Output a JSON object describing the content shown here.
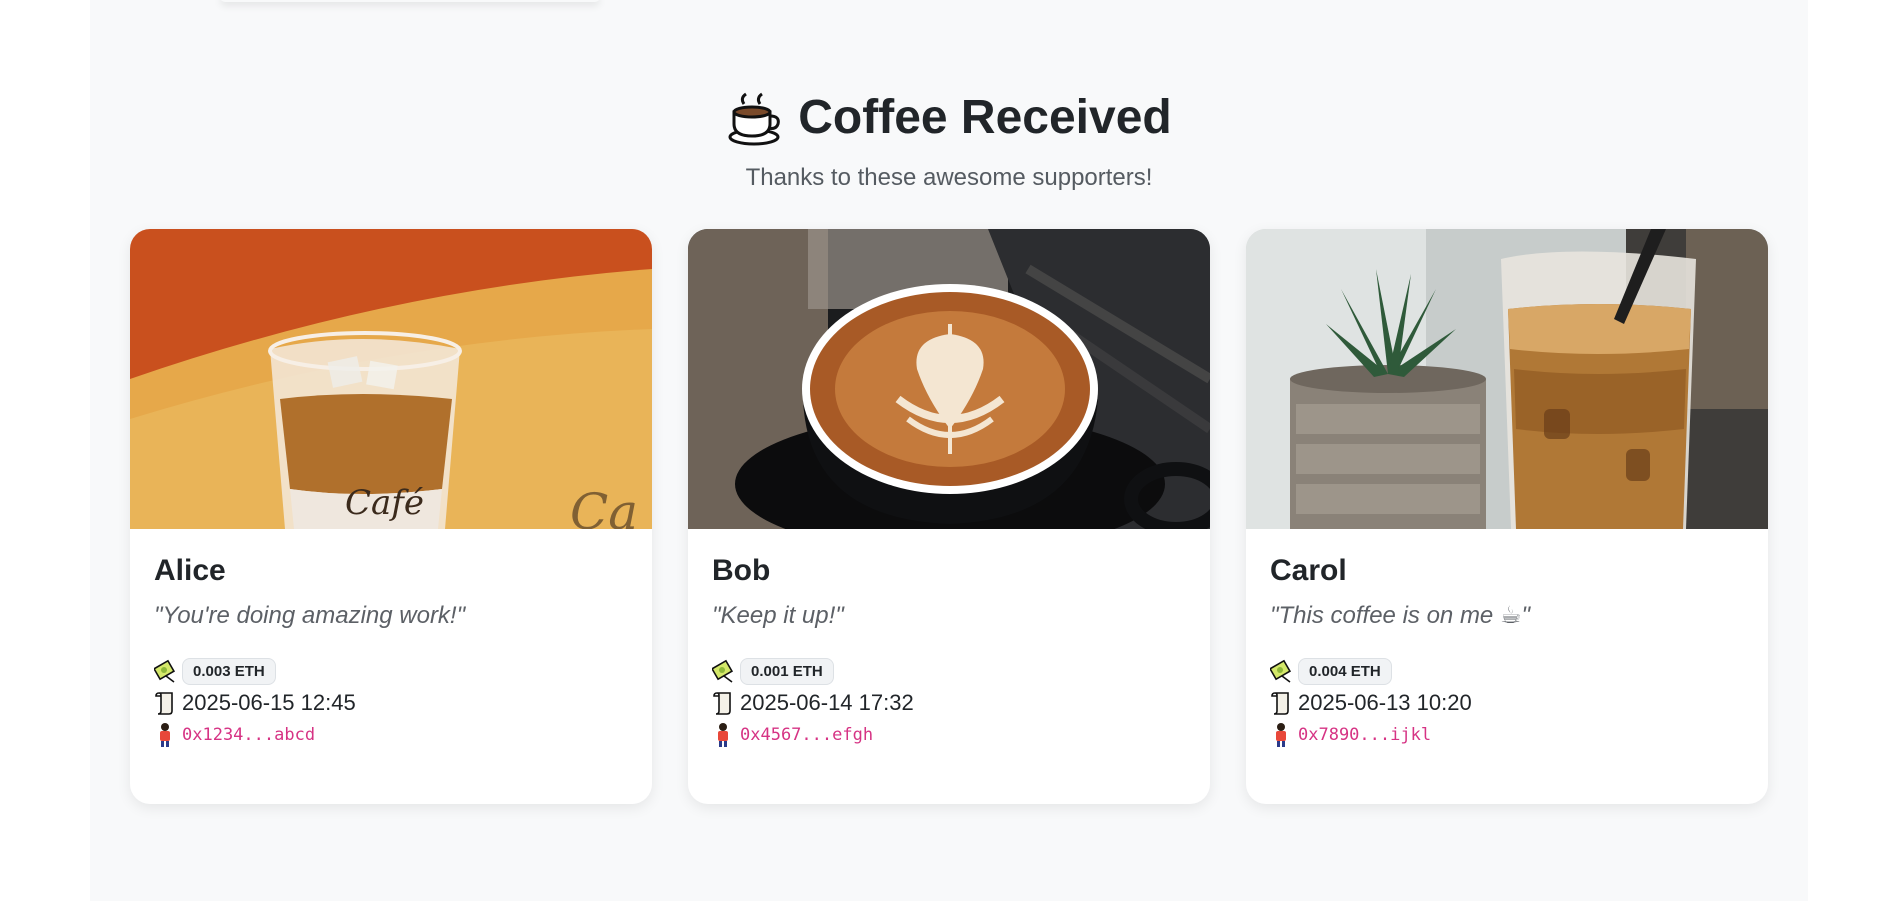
{
  "header": {
    "icon": "coffee-cup-icon",
    "title": "Coffee Received",
    "subtitle": "Thanks to these awesome supporters!"
  },
  "colors": {
    "page_bg": "#f8f9fa",
    "address": "#d63384",
    "badge_bg": "#f1f3f5"
  },
  "supporters": [
    {
      "name": "Alice",
      "message": "\"You're doing amazing work!\"",
      "amount": "0.003 ETH",
      "date": "2025-06-15 12:45",
      "address": "0x1234...abcd",
      "photo": "iced-latte-photo"
    },
    {
      "name": "Bob",
      "message": "\"Keep it up!\"",
      "amount": "0.001 ETH",
      "date": "2025-06-14 17:32",
      "address": "0x4567...efgh",
      "photo": "latte-art-photo"
    },
    {
      "name": "Carol",
      "message": "\"This coffee is on me ☕\"",
      "amount": "0.004 ETH",
      "date": "2025-06-13 10:20",
      "address": "0x7890...ijkl",
      "photo": "iced-coffee-cactus-photo"
    }
  ],
  "meta_icons": {
    "amount": "money-icon",
    "date": "scroll-icon",
    "address": "person-icon"
  }
}
